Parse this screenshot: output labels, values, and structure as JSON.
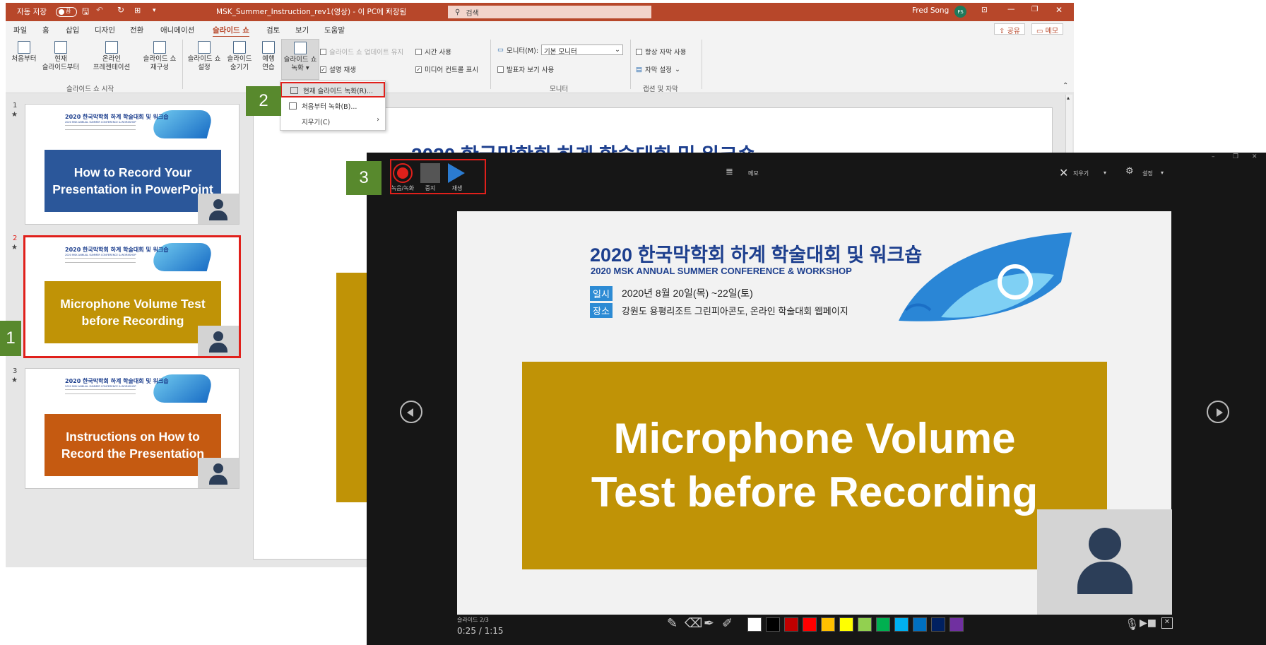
{
  "titlebar": {
    "autosave_label": "자동 저장",
    "autosave_state": "끔",
    "filename": "MSK_Summer_Instruction_rev1(영상) - 이 PC에 저장됨",
    "search_placeholder": "검색",
    "user_name": "Fred Song",
    "user_initials": "FS",
    "accent": "#b7472a"
  },
  "menu": {
    "items": [
      "파일",
      "홈",
      "삽입",
      "디자인",
      "전환",
      "애니메이션",
      "슬라이드 쇼",
      "검토",
      "보기",
      "도움말"
    ],
    "active": "슬라이드 쇼",
    "share_label": "공유",
    "comment_label": "메모"
  },
  "ribbon": {
    "from_beginning": "처음부터",
    "from_current": [
      "현재",
      "슬라이드부터"
    ],
    "online_present": [
      "온라인",
      "프레젠테이션"
    ],
    "custom_show": [
      "슬라이드 쇼",
      "재구성"
    ],
    "group_start": "슬라이드 쇼 시작",
    "setup_show": [
      "슬라이드 쇼",
      "설정"
    ],
    "hide_slide": [
      "슬라이드",
      "숨기기"
    ],
    "rehearse": [
      "예행",
      "연습"
    ],
    "record": [
      "슬라이드 쇼",
      "녹화"
    ],
    "keep_updated": "슬라이드 쇼 업데이트 유지",
    "play_narrations": "설명 재생",
    "use_timings": "시간 사용",
    "show_media_controls": "미디어 컨트롤 표시",
    "monitor_label": "모니터(M):",
    "monitor_value": "기본 모니터",
    "presenter_view": "발표자 보기 사용",
    "group_monitor": "모니터",
    "always_subtitles": "항상 자막 사용",
    "subtitle_settings": "자막 설정",
    "group_captions": "캡션 및 자막"
  },
  "dropdown": {
    "items": [
      "현재 슬라이드 녹화(R)...",
      "처음부터 녹화(B)...",
      "지우기(C)"
    ]
  },
  "slides": [
    {
      "number": "1",
      "title": "How to Record Your Presentation in PowerPoint",
      "color": "#2b579a"
    },
    {
      "number": "2",
      "title": "Microphone Volume Test before Recording",
      "color": "#c09306"
    },
    {
      "number": "3",
      "title": "Instructions on How to Record the Presentation",
      "color": "#c55a11"
    }
  ],
  "slide_header": {
    "title": "2020 한국막학회 하계 학술대회 및 워크숍",
    "subtitle": "2020 MSK ANNUAL SUMMER CONFERENCE & WORKSHOP",
    "date_tag": "일시",
    "date": "2020년 8월 20일(목) ~22일(토)",
    "place_tag": "장소",
    "place": "강원도 용평리조트 그린피아콘도, 온라인 학술대회 웹페이지"
  },
  "main_peek_title": "2020 한국막학회 하계 학술대회 및 워크숍",
  "badges": [
    "1",
    "2",
    "3"
  ],
  "recorder": {
    "record_label": "녹음/녹화",
    "stop_label": "중지",
    "play_label": "재생",
    "notes_label": "메모",
    "clear_label": "지우기",
    "settings_label": "설정",
    "slide_counter": "슬라이드 2/3",
    "time": "0:25 / 1:15",
    "slide_text": "Microphone Volume Test before Recording",
    "pen_colors": [
      "#ffffff",
      "#000000",
      "#c00000",
      "#ff0000",
      "#ffc000",
      "#ffff00",
      "#92d050",
      "#00b050",
      "#00b0f0",
      "#0070c0",
      "#002060",
      "#7030a0"
    ]
  }
}
